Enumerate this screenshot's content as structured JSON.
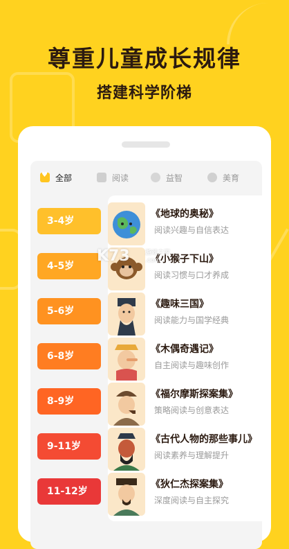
{
  "headline": {
    "main": "尊重儿童成长规律",
    "sub": "搭建科学阶梯"
  },
  "tabs": [
    {
      "label": "全部",
      "icon": "heart-folder-icon",
      "active": true
    },
    {
      "label": "阅读",
      "icon": "book-icon",
      "active": false
    },
    {
      "label": "益智",
      "icon": "brain-icon",
      "active": false
    },
    {
      "label": "美育",
      "icon": "palette-icon",
      "active": false
    }
  ],
  "ages": [
    {
      "label": "3-4岁",
      "color": "#FFC02B"
    },
    {
      "label": "4-5岁",
      "color": "#FFA723"
    },
    {
      "label": "5-6岁",
      "color": "#FF9220"
    },
    {
      "label": "6-8岁",
      "color": "#FF7D21"
    },
    {
      "label": "8-9岁",
      "color": "#FF6523"
    },
    {
      "label": "9-11岁",
      "color": "#F44B33"
    },
    {
      "label": "11-12岁",
      "color": "#E93838"
    }
  ],
  "books": [
    {
      "title": "《地球的奥秘》",
      "desc": "阅读兴趣与自信表达",
      "thumb": "earth-illustration"
    },
    {
      "title": "《小猴子下山》",
      "desc": "阅读习惯与口才养成",
      "thumb": "monkey-illustration"
    },
    {
      "title": "《趣味三国》",
      "desc": "阅读能力与国学经典",
      "thumb": "three-kingdoms-illustration"
    },
    {
      "title": "《木偶奇遇记》",
      "desc": "自主阅读与趣味创作",
      "thumb": "pinocchio-illustration"
    },
    {
      "title": "《福尔摩斯探案集》",
      "desc": "策略阅读与创意表达",
      "thumb": "sherlock-illustration"
    },
    {
      "title": "《古代人物的那些事儿》",
      "desc": "阅读素养与理解提升",
      "thumb": "ancient-figure-illustration"
    },
    {
      "title": "《狄仁杰探案集》",
      "desc": "深度阅读与自主探究",
      "thumb": "di-renjie-illustration"
    }
  ],
  "watermark": {
    "logo": "K73",
    "line1": "游戏之家",
    "line2": ".com"
  },
  "colors": {
    "background": "#FFD21F",
    "title": "#2B1A10",
    "active_tab": "#FFC520"
  }
}
